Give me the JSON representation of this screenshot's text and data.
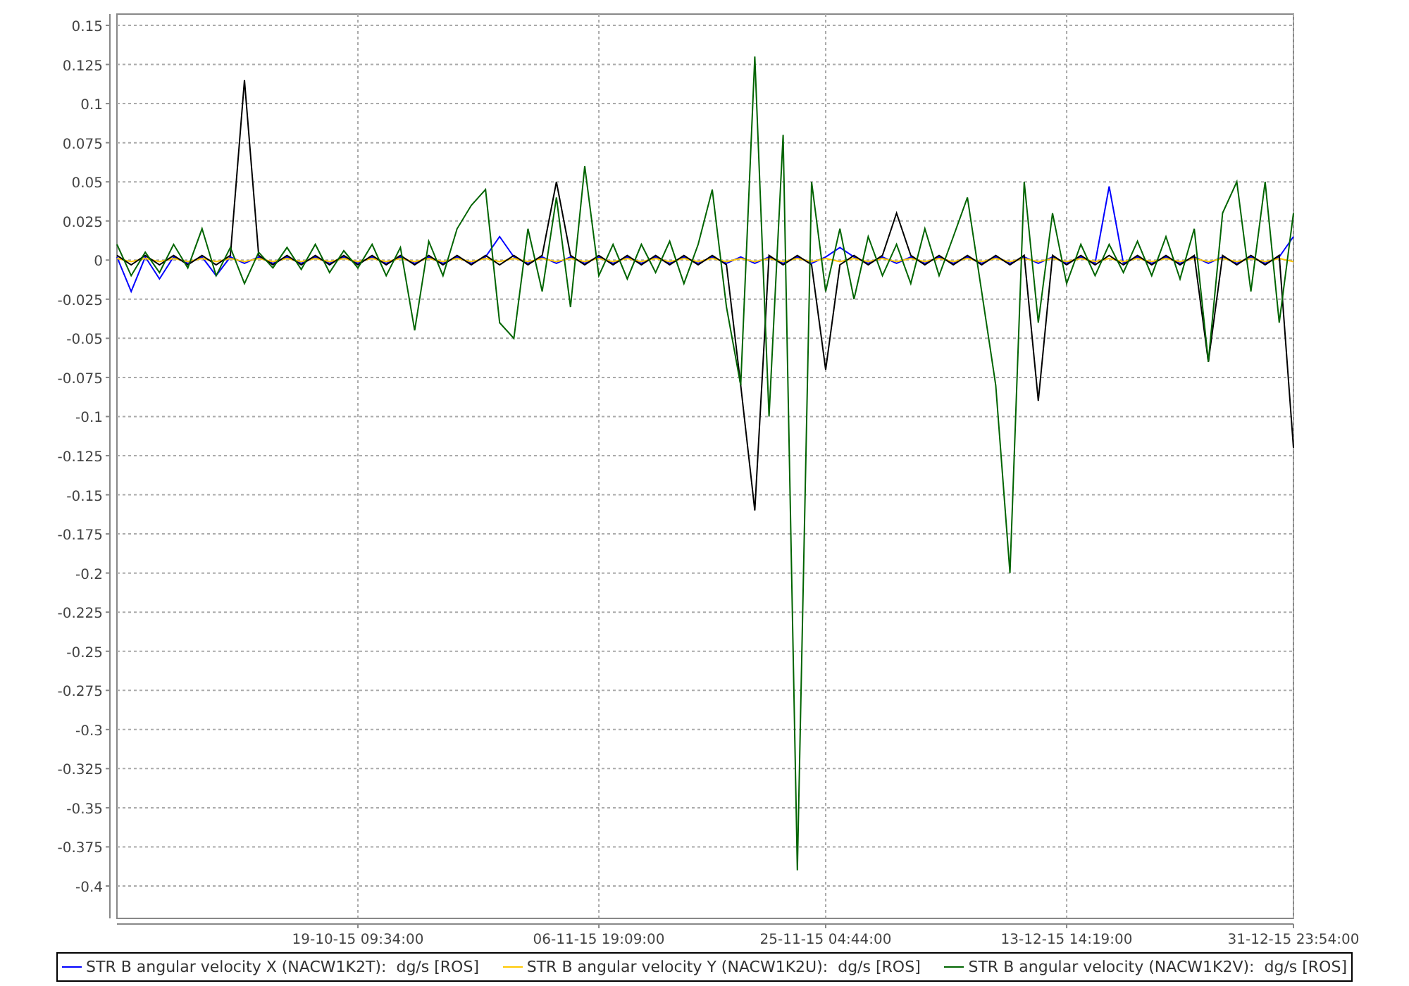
{
  "chart_data": {
    "type": "line",
    "grid": true,
    "ylim": [
      -0.4207,
      0.1572
    ],
    "categories": [
      null,
      null,
      null,
      null,
      null,
      null,
      null,
      null,
      null,
      null,
      null,
      null,
      null,
      null,
      null,
      null,
      null,
      "19-10-15 09:34:00",
      null,
      null,
      null,
      null,
      null,
      null,
      null,
      null,
      null,
      null,
      null,
      null,
      null,
      null,
      null,
      null,
      "06-11-15 19:09:00",
      null,
      null,
      null,
      null,
      null,
      null,
      null,
      null,
      null,
      null,
      null,
      null,
      null,
      null,
      null,
      "25-11-15 04:44:00",
      null,
      null,
      null,
      null,
      null,
      null,
      null,
      null,
      null,
      null,
      null,
      null,
      null,
      null,
      null,
      null,
      "13-12-15 14:19:00",
      null,
      null,
      null,
      null,
      null,
      null,
      null,
      null,
      null,
      null,
      null,
      null,
      null,
      null,
      null,
      "31-12-15 23:54:00"
    ],
    "yticks": [
      {
        "value": 0.15,
        "label": "0.15"
      },
      {
        "value": 0.125,
        "label": "0.125"
      },
      {
        "value": 0.1,
        "label": "0.1"
      },
      {
        "value": 0.075,
        "label": "0.075"
      },
      {
        "value": 0.05,
        "label": "0.05"
      },
      {
        "value": 0.025,
        "label": "0.025"
      },
      {
        "value": 0,
        "label": "0"
      },
      {
        "value": -0.025,
        "label": "-0.025"
      },
      {
        "value": -0.05,
        "label": "-0.05"
      },
      {
        "value": -0.075,
        "label": "-0.075"
      },
      {
        "value": -0.1,
        "label": "-0.1"
      },
      {
        "value": -0.125,
        "label": "-0.125"
      },
      {
        "value": -0.15,
        "label": "-0.15"
      },
      {
        "value": -0.175,
        "label": "-0.175"
      },
      {
        "value": -0.2,
        "label": "-0.2"
      },
      {
        "value": -0.225,
        "label": "-0.225"
      },
      {
        "value": -0.25,
        "label": "-0.25"
      },
      {
        "value": -0.275,
        "label": "-0.275"
      },
      {
        "value": -0.3,
        "label": "-0.3"
      },
      {
        "value": -0.325,
        "label": "-0.325"
      },
      {
        "value": -0.35,
        "label": "-0.35"
      },
      {
        "value": -0.375,
        "label": "-0.375"
      },
      {
        "value": -0.4,
        "label": "-0.4"
      }
    ],
    "series": [
      {
        "name": "STR B angular velocity X (NACW1K2T):  dg/s [ROS]",
        "color": "#0000ff",
        "values": [
          0.002,
          -0.02,
          0.002,
          -0.012,
          0.002,
          -0.002,
          0.002,
          -0.01,
          0.002,
          -0.002,
          0.002,
          -0.002,
          0.002,
          -0.002,
          0.002,
          -0.002,
          0.002,
          -0.002,
          0.002,
          -0.002,
          0.002,
          -0.002,
          0.002,
          -0.002,
          0.002,
          -0.002,
          0.002,
          0.015,
          0.002,
          -0.002,
          0.002,
          -0.002,
          0.002,
          -0.002,
          0.002,
          -0.002,
          0.002,
          -0.002,
          0.002,
          -0.002,
          0.002,
          -0.002,
          0.002,
          -0.002,
          0.002,
          -0.002,
          0.002,
          -0.002,
          0.002,
          -0.002,
          0.002,
          0.008,
          0.002,
          -0.002,
          0.002,
          -0.002,
          0.002,
          -0.002,
          0.002,
          -0.002,
          0.002,
          -0.002,
          0.002,
          -0.002,
          0.002,
          -0.002,
          0.002,
          -0.002,
          0.002,
          -0.002,
          0.047,
          -0.002,
          0.002,
          -0.002,
          0.002,
          -0.002,
          0.002,
          -0.002,
          0.002,
          -0.002,
          0.002,
          -0.002,
          0.002,
          0.015
        ]
      },
      {
        "name": "STR B angular velocity Y (NACW1K2U):  dg/s [ROS]",
        "color": "#ffc800",
        "values": [
          0.001,
          -0.001,
          0.001,
          -0.001,
          0.001,
          -0.001,
          0.001,
          -0.001,
          0.001,
          -0.001,
          0.001,
          -0.001,
          0.001,
          -0.001,
          0.001,
          -0.001,
          0.001,
          -0.001,
          0.001,
          -0.001,
          0.001,
          -0.001,
          0.001,
          -0.001,
          0.001,
          -0.001,
          0.001,
          -0.001,
          0.001,
          -0.001,
          0.001,
          -0.001,
          0.001,
          -0.001,
          0.001,
          -0.001,
          0.001,
          -0.001,
          0.001,
          -0.001,
          0.001,
          -0.001,
          0.001,
          -0.001,
          0.001,
          -0.001,
          0.001,
          -0.001,
          0.001,
          -0.001,
          0.001,
          -0.001,
          0.001,
          -0.001,
          0.001,
          -0.001,
          0.001,
          -0.001,
          0.001,
          -0.001,
          0.001,
          -0.001,
          0.001,
          -0.001,
          0.001,
          -0.001,
          0.001,
          -0.001,
          0.001,
          -0.001,
          0.001,
          -0.001,
          0.001,
          -0.001,
          0.001,
          -0.001,
          0.001,
          -0.001,
          0.001,
          -0.001,
          0.001,
          -0.001,
          0.001,
          -0.001
        ]
      },
      {
        "color": "#000000",
        "values": [
          0.003,
          -0.003,
          0.003,
          -0.003,
          0.003,
          -0.003,
          0.003,
          -0.003,
          0.003,
          0.115,
          0.003,
          -0.003,
          0.003,
          -0.003,
          0.003,
          -0.003,
          0.003,
          -0.003,
          0.003,
          -0.003,
          0.003,
          -0.003,
          0.003,
          -0.003,
          0.003,
          -0.003,
          0.003,
          -0.003,
          0.003,
          -0.003,
          0.003,
          0.05,
          0.003,
          -0.003,
          0.003,
          -0.003,
          0.003,
          -0.003,
          0.003,
          -0.003,
          0.003,
          -0.003,
          0.003,
          -0.003,
          -0.08,
          -0.16,
          0.003,
          -0.003,
          0.003,
          -0.003,
          -0.07,
          -0.003,
          0.003,
          -0.003,
          0.003,
          0.03,
          0.003,
          -0.003,
          0.003,
          -0.003,
          0.003,
          -0.003,
          0.003,
          -0.003,
          0.003,
          -0.09,
          0.003,
          -0.003,
          0.003,
          -0.003,
          0.003,
          -0.003,
          0.003,
          -0.003,
          0.003,
          -0.003,
          0.003,
          -0.065,
          0.003,
          -0.003,
          0.003,
          -0.003,
          0.003,
          -0.12
        ]
      },
      {
        "name": "STR B angular velocity (NACW1K2V):  dg/s [ROS]",
        "color": "#006400",
        "values": [
          0.01,
          -0.01,
          0.005,
          -0.008,
          0.01,
          -0.005,
          0.02,
          -0.01,
          0.008,
          -0.015,
          0.005,
          -0.005,
          0.008,
          -0.006,
          0.01,
          -0.008,
          0.006,
          -0.005,
          0.01,
          -0.01,
          0.008,
          -0.045,
          0.012,
          -0.01,
          0.02,
          0.035,
          0.045,
          -0.04,
          -0.05,
          0.02,
          -0.02,
          0.04,
          -0.03,
          0.06,
          -0.01,
          0.01,
          -0.012,
          0.01,
          -0.008,
          0.012,
          -0.015,
          0.01,
          0.045,
          -0.03,
          -0.08,
          0.13,
          -0.1,
          0.08,
          -0.39,
          0.05,
          -0.02,
          0.02,
          -0.025,
          0.015,
          -0.01,
          0.01,
          -0.015,
          0.02,
          -0.01,
          0.015,
          0.04,
          -0.02,
          -0.08,
          -0.2,
          0.05,
          -0.04,
          0.03,
          -0.015,
          0.01,
          -0.01,
          0.01,
          -0.008,
          0.012,
          -0.01,
          0.015,
          -0.012,
          0.02,
          -0.065,
          0.03,
          0.05,
          -0.02,
          0.05,
          -0.04,
          0.03
        ]
      }
    ]
  }
}
